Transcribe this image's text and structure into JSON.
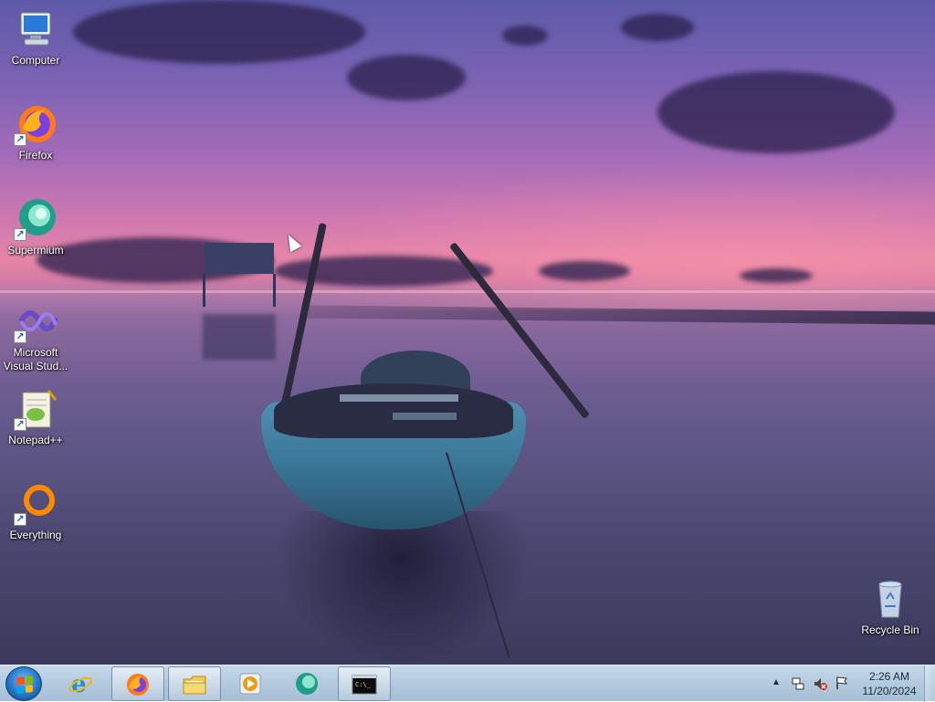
{
  "desktop_icons": [
    {
      "label": "Computer",
      "icon": "computer-icon",
      "shortcut": false
    },
    {
      "label": "Firefox",
      "icon": "firefox-icon",
      "shortcut": true
    },
    {
      "label": "Supermium",
      "icon": "supermium-icon",
      "shortcut": true
    },
    {
      "label": "Microsoft Visual Stud...",
      "icon": "visual-studio-icon",
      "shortcut": true
    },
    {
      "label": "Notepad++",
      "icon": "notepadpp-icon",
      "shortcut": true
    },
    {
      "label": "Everything",
      "icon": "everything-icon",
      "shortcut": true
    },
    {
      "label": "Recycle Bin",
      "icon": "recycle-bin-icon",
      "shortcut": false
    }
  ],
  "taskbar": {
    "pinned": [
      {
        "name": "internet-explorer",
        "icon": "internet-explorer-icon"
      },
      {
        "name": "firefox",
        "icon": "firefox-icon",
        "active": true
      },
      {
        "name": "file-explorer",
        "icon": "folder-icon",
        "active": true
      },
      {
        "name": "media-player",
        "icon": "media-player-icon"
      },
      {
        "name": "supermium",
        "icon": "supermium-icon"
      },
      {
        "name": "command-prompt",
        "icon": "cmd-icon",
        "active": true
      }
    ],
    "tray": {
      "time": "2:26 AM",
      "date": "11/20/2024",
      "icons": [
        "chevron-up-icon",
        "network-icon",
        "volume-muted-icon",
        "action-center-flag-icon"
      ]
    }
  },
  "colors": {
    "taskbar": "#b4cbe0",
    "label_text": "#ffffff"
  }
}
